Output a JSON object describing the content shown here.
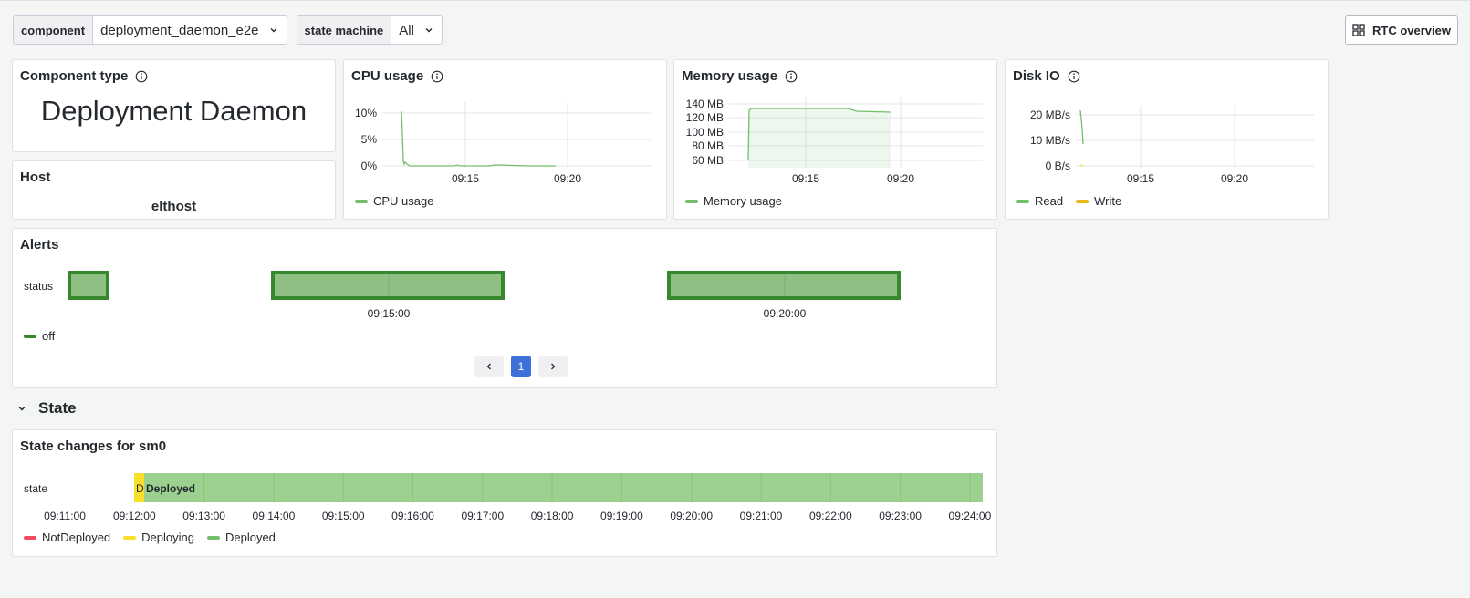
{
  "variables": {
    "component": {
      "label": "component",
      "value": "deployment_daemon_e2e"
    },
    "state_machine": {
      "label": "state machine",
      "value": "All"
    }
  },
  "rtc_button": {
    "label": "RTC overview"
  },
  "panels": {
    "component_type": {
      "title": "Component type",
      "value": "Deployment Daemon"
    },
    "host": {
      "title": "Host",
      "value": "elthost"
    },
    "cpu": {
      "title": "CPU usage",
      "legend": "CPU usage",
      "yticks": [
        "10%",
        "5%",
        "0%"
      ],
      "xticks": [
        "09:15",
        "09:20"
      ]
    },
    "memory": {
      "title": "Memory usage",
      "legend": "Memory usage",
      "yticks": [
        "140 MB",
        "120 MB",
        "100 MB",
        "80 MB",
        "60 MB"
      ],
      "xticks": [
        "09:15",
        "09:20"
      ]
    },
    "disk": {
      "title": "Disk IO",
      "legend_read": "Read",
      "legend_write": "Write",
      "yticks": [
        "20 MB/s",
        "10 MB/s",
        "0 B/s"
      ],
      "xticks": [
        "09:15",
        "09:20"
      ]
    },
    "alerts": {
      "title": "Alerts",
      "row_label": "status",
      "xticks": [
        "09:15:00",
        "09:20:00"
      ],
      "legend": "off",
      "page": "1"
    },
    "state": {
      "title": "State changes for sm0",
      "row_label": "state",
      "segment_short": "D",
      "segment_label": "Deployed",
      "xticks": [
        "09:11:00",
        "09:12:00",
        "09:13:00",
        "09:14:00",
        "09:15:00",
        "09:16:00",
        "09:17:00",
        "09:18:00",
        "09:19:00",
        "09:20:00",
        "09:21:00",
        "09:22:00",
        "09:23:00",
        "09:24:00"
      ],
      "legend": [
        "NotDeployed",
        "Deploying",
        "Deployed"
      ]
    }
  },
  "row": {
    "title": "State"
  },
  "colors": {
    "green": "#73bf69",
    "yellow": "#fade2a",
    "red": "#f2495c",
    "alert_green": "#37872d",
    "blue": "#3d71d9"
  }
}
